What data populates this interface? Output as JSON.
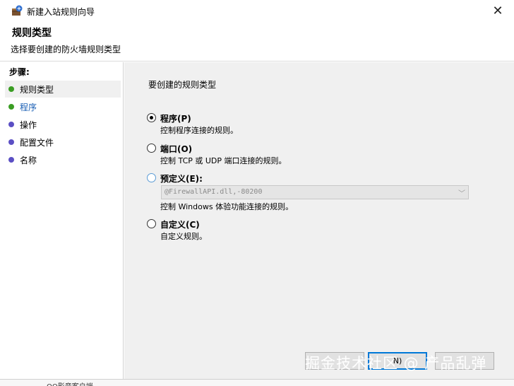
{
  "window": {
    "title": "新建入站规则向导",
    "close_icon": "close-icon"
  },
  "header": {
    "title": "规则类型",
    "subtitle": "选择要创建的防火墙规则类型"
  },
  "steps": {
    "label": "步骤:",
    "items": [
      {
        "label": "规则类型",
        "color": "#3a9d23"
      },
      {
        "label": "程序",
        "color": "#3a9d23"
      },
      {
        "label": "操作",
        "color": "#5b4fc4"
      },
      {
        "label": "配置文件",
        "color": "#5b4fc4"
      },
      {
        "label": "名称",
        "color": "#5b4fc4"
      }
    ]
  },
  "main": {
    "prompt": "要创建的规则类型",
    "options": [
      {
        "title": "程序(P)",
        "desc": "控制程序连接的规则。",
        "checked": true
      },
      {
        "title": "端口(O)",
        "desc": "控制 TCP 或 UDP 端口连接的规则。",
        "checked": false
      },
      {
        "title": "预定义(E):",
        "desc": "控制 Windows 体验功能连接的规则。",
        "checked": false
      },
      {
        "title": "自定义(C)",
        "desc": "自定义规则。",
        "checked": false
      }
    ],
    "predefined_value": "@FirewallAPI.dll,-80200"
  },
  "buttons": {
    "back": "",
    "next": "N)",
    "cancel": ""
  },
  "watermark": "掘金技术社区 @ 产品乱弹",
  "background_row": "QQ影音客户端"
}
